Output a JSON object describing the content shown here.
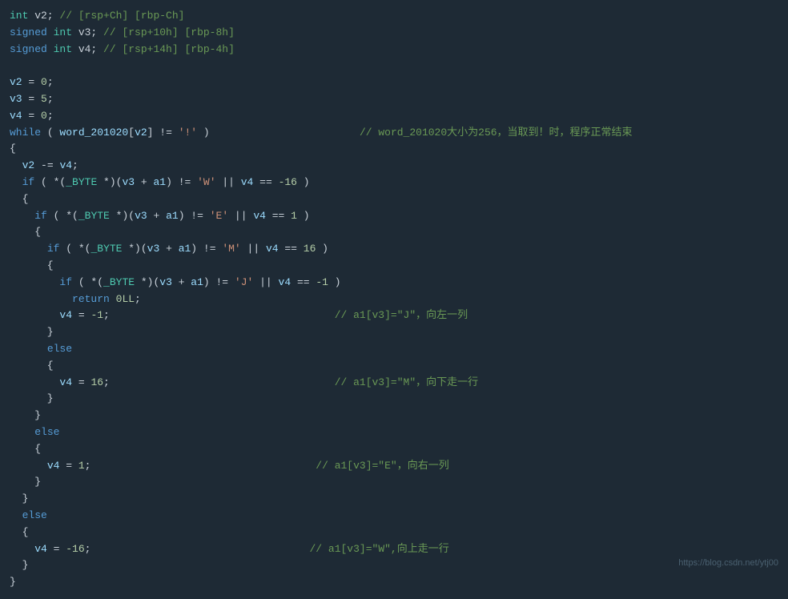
{
  "code": {
    "lines": [
      {
        "id": "l1",
        "parts": [
          {
            "t": "type",
            "v": "int"
          },
          {
            "t": "op",
            "v": " v2; "
          },
          {
            "t": "comment",
            "v": "// [rsp+Ch] [rbp-Ch]"
          }
        ]
      },
      {
        "id": "l2",
        "parts": [
          {
            "t": "kw",
            "v": "signed"
          },
          {
            "t": "op",
            "v": " "
          },
          {
            "t": "type",
            "v": "int"
          },
          {
            "t": "op",
            "v": " v3; "
          },
          {
            "t": "comment",
            "v": "// [rsp+10h] [rbp-8h]"
          }
        ]
      },
      {
        "id": "l3",
        "parts": [
          {
            "t": "kw",
            "v": "signed"
          },
          {
            "t": "op",
            "v": " "
          },
          {
            "t": "type",
            "v": "int"
          },
          {
            "t": "op",
            "v": " v4; "
          },
          {
            "t": "comment",
            "v": "// [rsp+14h] [rbp-4h]"
          }
        ]
      },
      {
        "id": "l4",
        "blank": true
      },
      {
        "id": "l5",
        "parts": [
          {
            "t": "var",
            "v": "v2"
          },
          {
            "t": "op",
            "v": " = "
          },
          {
            "t": "num",
            "v": "0"
          },
          {
            "t": "op",
            "v": ";"
          }
        ]
      },
      {
        "id": "l6",
        "parts": [
          {
            "t": "var",
            "v": "v3"
          },
          {
            "t": "op",
            "v": " = "
          },
          {
            "t": "num",
            "v": "5"
          },
          {
            "t": "op",
            "v": ";"
          }
        ]
      },
      {
        "id": "l7",
        "parts": [
          {
            "t": "var",
            "v": "v4"
          },
          {
            "t": "op",
            "v": " = "
          },
          {
            "t": "num",
            "v": "0"
          },
          {
            "t": "op",
            "v": ";"
          }
        ]
      },
      {
        "id": "l8",
        "parts": [
          {
            "t": "kw",
            "v": "while"
          },
          {
            "t": "op",
            "v": " ( "
          },
          {
            "t": "var",
            "v": "word_201020"
          },
          {
            "t": "op",
            "v": "["
          },
          {
            "t": "var",
            "v": "v2"
          },
          {
            "t": "op",
            "v": "] != "
          },
          {
            "t": "str",
            "v": "'!'"
          },
          {
            "t": "op",
            "v": " )                        "
          },
          {
            "t": "comment",
            "v": "// word_201020大小为256，当取到！时，程序正常结束"
          }
        ]
      },
      {
        "id": "l9",
        "parts": [
          {
            "t": "op",
            "v": "{"
          }
        ]
      },
      {
        "id": "l10",
        "parts": [
          {
            "t": "op",
            "v": "  "
          },
          {
            "t": "var",
            "v": "v2"
          },
          {
            "t": "op",
            "v": " -= "
          },
          {
            "t": "var",
            "v": "v4"
          },
          {
            "t": "op",
            "v": ";"
          }
        ]
      },
      {
        "id": "l11",
        "parts": [
          {
            "t": "op",
            "v": "  "
          },
          {
            "t": "kw",
            "v": "if"
          },
          {
            "t": "op",
            "v": " ( *("
          },
          {
            "t": "cast",
            "v": "_BYTE"
          },
          {
            "t": "op",
            "v": " *)("
          },
          {
            "t": "var",
            "v": "v3"
          },
          {
            "t": "op",
            "v": " + "
          },
          {
            "t": "var",
            "v": "a1"
          },
          {
            "t": "op",
            "v": ") != "
          },
          {
            "t": "str",
            "v": "'W'"
          },
          {
            "t": "op",
            "v": " || "
          },
          {
            "t": "var",
            "v": "v4"
          },
          {
            "t": "op",
            "v": " == "
          },
          {
            "t": "num",
            "v": "-16"
          },
          {
            "t": "op",
            "v": " )"
          }
        ]
      },
      {
        "id": "l12",
        "parts": [
          {
            "t": "op",
            "v": "  {"
          }
        ]
      },
      {
        "id": "l13",
        "parts": [
          {
            "t": "op",
            "v": "    "
          },
          {
            "t": "kw",
            "v": "if"
          },
          {
            "t": "op",
            "v": " ( *("
          },
          {
            "t": "cast",
            "v": "_BYTE"
          },
          {
            "t": "op",
            "v": " *)("
          },
          {
            "t": "var",
            "v": "v3"
          },
          {
            "t": "op",
            "v": " + "
          },
          {
            "t": "var",
            "v": "a1"
          },
          {
            "t": "op",
            "v": ") != "
          },
          {
            "t": "str",
            "v": "'E'"
          },
          {
            "t": "op",
            "v": " || "
          },
          {
            "t": "var",
            "v": "v4"
          },
          {
            "t": "op",
            "v": " == "
          },
          {
            "t": "num",
            "v": "1"
          },
          {
            "t": "op",
            "v": " )"
          }
        ]
      },
      {
        "id": "l14",
        "parts": [
          {
            "t": "op",
            "v": "    {"
          }
        ]
      },
      {
        "id": "l15",
        "parts": [
          {
            "t": "op",
            "v": "      "
          },
          {
            "t": "kw",
            "v": "if"
          },
          {
            "t": "op",
            "v": " ( *("
          },
          {
            "t": "cast",
            "v": "_BYTE"
          },
          {
            "t": "op",
            "v": " *)("
          },
          {
            "t": "var",
            "v": "v3"
          },
          {
            "t": "op",
            "v": " + "
          },
          {
            "t": "var",
            "v": "a1"
          },
          {
            "t": "op",
            "v": ") != "
          },
          {
            "t": "str",
            "v": "'M'"
          },
          {
            "t": "op",
            "v": " || "
          },
          {
            "t": "var",
            "v": "v4"
          },
          {
            "t": "op",
            "v": " == "
          },
          {
            "t": "num",
            "v": "16"
          },
          {
            "t": "op",
            "v": " )"
          }
        ]
      },
      {
        "id": "l16",
        "parts": [
          {
            "t": "op",
            "v": "      {"
          }
        ]
      },
      {
        "id": "l17",
        "parts": [
          {
            "t": "op",
            "v": "        "
          },
          {
            "t": "kw",
            "v": "if"
          },
          {
            "t": "op",
            "v": " ( *("
          },
          {
            "t": "cast",
            "v": "_BYTE"
          },
          {
            "t": "op",
            "v": " *)("
          },
          {
            "t": "var",
            "v": "v3"
          },
          {
            "t": "op",
            "v": " + "
          },
          {
            "t": "var",
            "v": "a1"
          },
          {
            "t": "op",
            "v": ") != "
          },
          {
            "t": "str",
            "v": "'J'"
          },
          {
            "t": "op",
            "v": " || "
          },
          {
            "t": "var",
            "v": "v4"
          },
          {
            "t": "op",
            "v": " == "
          },
          {
            "t": "num",
            "v": "-1"
          },
          {
            "t": "op",
            "v": " )"
          }
        ]
      },
      {
        "id": "l18",
        "parts": [
          {
            "t": "op",
            "v": "          "
          },
          {
            "t": "kw",
            "v": "return"
          },
          {
            "t": "op",
            "v": " "
          },
          {
            "t": "num",
            "v": "0LL"
          },
          {
            "t": "op",
            "v": ";"
          }
        ]
      },
      {
        "id": "l19",
        "parts": [
          {
            "t": "op",
            "v": "        "
          },
          {
            "t": "var",
            "v": "v4"
          },
          {
            "t": "op",
            "v": " = "
          },
          {
            "t": "num",
            "v": "-1"
          },
          {
            "t": "op",
            "v": ";                                    "
          },
          {
            "t": "comment",
            "v": "// a1[v3]=\"J\"，向左一列"
          }
        ]
      },
      {
        "id": "l20",
        "parts": [
          {
            "t": "op",
            "v": "      }"
          }
        ]
      },
      {
        "id": "l21",
        "parts": [
          {
            "t": "op",
            "v": "      "
          },
          {
            "t": "kw",
            "v": "else"
          }
        ]
      },
      {
        "id": "l22",
        "parts": [
          {
            "t": "op",
            "v": "      {"
          }
        ]
      },
      {
        "id": "l23",
        "parts": [
          {
            "t": "op",
            "v": "        "
          },
          {
            "t": "var",
            "v": "v4"
          },
          {
            "t": "op",
            "v": " = "
          },
          {
            "t": "num",
            "v": "16"
          },
          {
            "t": "op",
            "v": ";                                    "
          },
          {
            "t": "comment",
            "v": "// a1[v3]=\"M\"，向下走一行"
          }
        ]
      },
      {
        "id": "l24",
        "parts": [
          {
            "t": "op",
            "v": "      }"
          }
        ]
      },
      {
        "id": "l25",
        "parts": [
          {
            "t": "op",
            "v": "    }"
          }
        ]
      },
      {
        "id": "l26",
        "parts": [
          {
            "t": "op",
            "v": "    "
          },
          {
            "t": "kw",
            "v": "else"
          }
        ]
      },
      {
        "id": "l27",
        "parts": [
          {
            "t": "op",
            "v": "    {"
          }
        ]
      },
      {
        "id": "l28",
        "parts": [
          {
            "t": "op",
            "v": "      "
          },
          {
            "t": "var",
            "v": "v4"
          },
          {
            "t": "op",
            "v": " = "
          },
          {
            "t": "num",
            "v": "1"
          },
          {
            "t": "op",
            "v": ";                                    "
          },
          {
            "t": "comment",
            "v": "// a1[v3]=\"E\"，向右一列"
          }
        ]
      },
      {
        "id": "l29",
        "parts": [
          {
            "t": "op",
            "v": "    }"
          }
        ]
      },
      {
        "id": "l30",
        "parts": [
          {
            "t": "op",
            "v": "  }"
          }
        ]
      },
      {
        "id": "l31",
        "parts": [
          {
            "t": "op",
            "v": "  "
          },
          {
            "t": "kw",
            "v": "else"
          }
        ]
      },
      {
        "id": "l32",
        "parts": [
          {
            "t": "op",
            "v": "  {"
          }
        ]
      },
      {
        "id": "l33",
        "parts": [
          {
            "t": "op",
            "v": "    "
          },
          {
            "t": "var",
            "v": "v4"
          },
          {
            "t": "op",
            "v": " = "
          },
          {
            "t": "num",
            "v": "-16"
          },
          {
            "t": "op",
            "v": ";                                   "
          },
          {
            "t": "comment",
            "v": "// a1[v3]=\"W\",向上走一行"
          }
        ]
      },
      {
        "id": "l34",
        "parts": [
          {
            "t": "op",
            "v": "  }"
          }
        ]
      },
      {
        "id": "l35",
        "parts": [
          {
            "t": "op",
            "v": "}"
          }
        ]
      }
    ]
  },
  "watermark": "https://blog.csdn.net/ytj00"
}
